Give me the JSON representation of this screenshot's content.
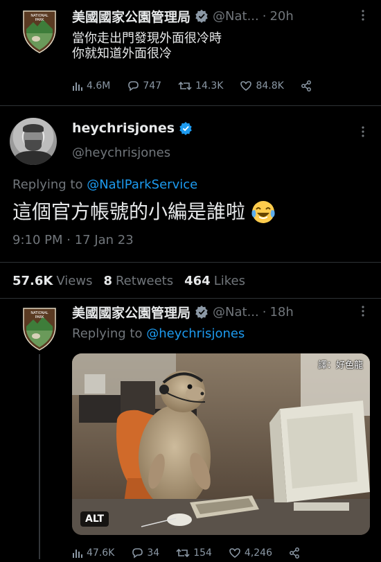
{
  "tweet1": {
    "name": "美國國家公園管理局",
    "handle": "@Nat...",
    "time": "20h",
    "text_line1": "當你走出門發現外面很冷時",
    "text_line2": "你就知道外面很冷",
    "views": "4.6M",
    "replies": "747",
    "retweets": "14.3K",
    "likes": "84.8K"
  },
  "tweet2": {
    "name": "heychrisjones",
    "handle": "@heychrisjones",
    "replying_prefix": "Replying to",
    "replying_to": "@NatlParkService",
    "text": "這個官方帳號的小編是誰啦",
    "emoji": "face-with-tears-of-joy",
    "timestamp": "9:10 PM · 17 Jan 23",
    "views_count": "57.6K",
    "views_label": "Views",
    "retweets_count": "8",
    "retweets_label": "Retweets",
    "likes_count": "464",
    "likes_label": "Likes"
  },
  "tweet3": {
    "name": "美國國家公園管理局",
    "handle": "@Nat...",
    "time": "18h",
    "replying_prefix": "Replying to",
    "replying_to": "@heychrisjones",
    "image_watermark": "譯：好色龍",
    "alt_label": "ALT",
    "views": "47.6K",
    "replies": "34",
    "retweets": "154",
    "likes": "4,246"
  },
  "dot": "·",
  "colors": {
    "background": "#000000",
    "text": "#e7e9ea",
    "secondary": "#71767b",
    "link": "#1d9bf0",
    "verified": "#1d9bf0"
  }
}
